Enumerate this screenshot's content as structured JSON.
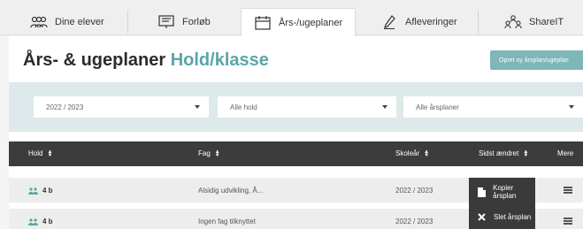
{
  "tabs": [
    {
      "label": "Dine elever",
      "icon": "students-icon",
      "active": false
    },
    {
      "label": "Forløb",
      "icon": "course-icon",
      "active": false
    },
    {
      "label": "Års-/ugeplaner",
      "icon": "calendar-icon",
      "active": true
    },
    {
      "label": "Afleveringer",
      "icon": "pen-icon",
      "active": false
    },
    {
      "label": "ShareIT",
      "icon": "share-people-icon",
      "active": false
    }
  ],
  "page": {
    "title_main": "Års- & ugeplaner",
    "title_accent": "Hold/klasse",
    "create_button": "Opret ny årsplan/ugeplan"
  },
  "filters": {
    "year": "2022 / 2023",
    "hold": "Alle hold",
    "plan": "Alle årsplaner"
  },
  "table": {
    "headers": [
      "Hold",
      "Fag",
      "Skoleår",
      "Sidst ændret",
      "Mere"
    ],
    "rows": [
      {
        "hold": "4 b",
        "fag": "Alsidig udvikling, Å...",
        "skoleaar": "2022 / 2023",
        "sidst": ""
      },
      {
        "hold": "4 b",
        "fag": "Ingen fag tilknyttet",
        "skoleaar": "2022 / 2023",
        "sidst": ""
      }
    ]
  },
  "dropdown_menu": {
    "items": [
      {
        "label": "Kopier årsplan",
        "icon": "copy-icon"
      },
      {
        "label": "Slet årsplan",
        "icon": "close-icon"
      }
    ]
  },
  "colors": {
    "accent": "#5aa5a8",
    "button": "#7fb6b8",
    "filterbar": "#dde9ea",
    "header": "#3c3c3c"
  }
}
